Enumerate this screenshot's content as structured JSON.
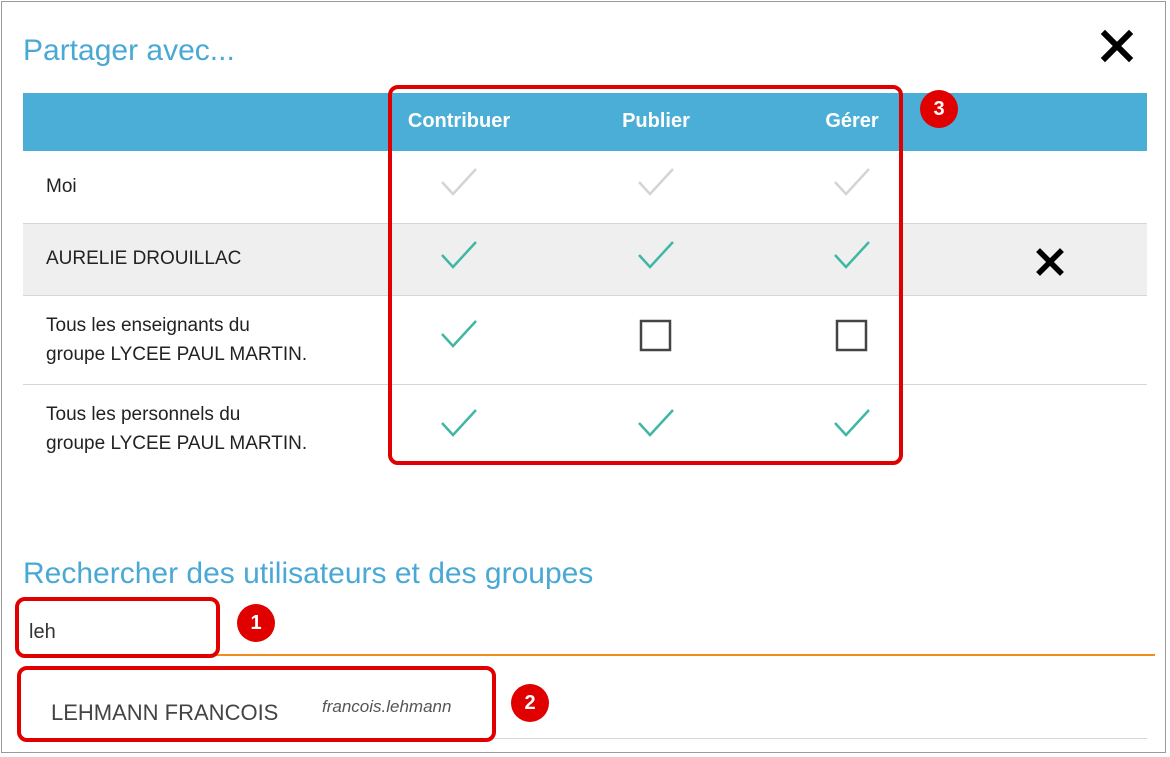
{
  "dialog": {
    "title": "Partager avec...",
    "close_icon": "close-icon"
  },
  "table": {
    "headers": [
      "",
      "Contribuer",
      "Publier",
      "Gérer"
    ],
    "rows": [
      {
        "name": "Moi",
        "contribuer": "disabled-checked",
        "publier": "disabled-checked",
        "gerer": "disabled-checked",
        "removable": false
      },
      {
        "name": "AURELIE DROUILLAC",
        "contribuer": "checked",
        "publier": "checked",
        "gerer": "checked",
        "removable": true
      },
      {
        "name_line1": "Tous les enseignants du",
        "name_line2": "groupe LYCEE PAUL MARTIN.",
        "contribuer": "checked",
        "publier": "unchecked",
        "gerer": "unchecked",
        "removable": false
      },
      {
        "name_line1": "Tous les personnels du",
        "name_line2": "groupe LYCEE PAUL MARTIN.",
        "contribuer": "checked",
        "publier": "checked",
        "gerer": "checked",
        "removable": false
      }
    ]
  },
  "search": {
    "title": "Rechercher des utilisateurs et des groupes",
    "value": "leh"
  },
  "results": [
    {
      "name": "LEHMANN FRANCOIS",
      "login": "francois.lehmann"
    }
  ],
  "annotations": [
    "1",
    "2",
    "3"
  ],
  "colors": {
    "accent": "#4aa9d4",
    "header_bg": "#4aaed6",
    "check": "#3fb8a3",
    "check_disabled": "#d4d4d4",
    "search_underline": "#f28c1c",
    "annotation": "#e00000"
  }
}
